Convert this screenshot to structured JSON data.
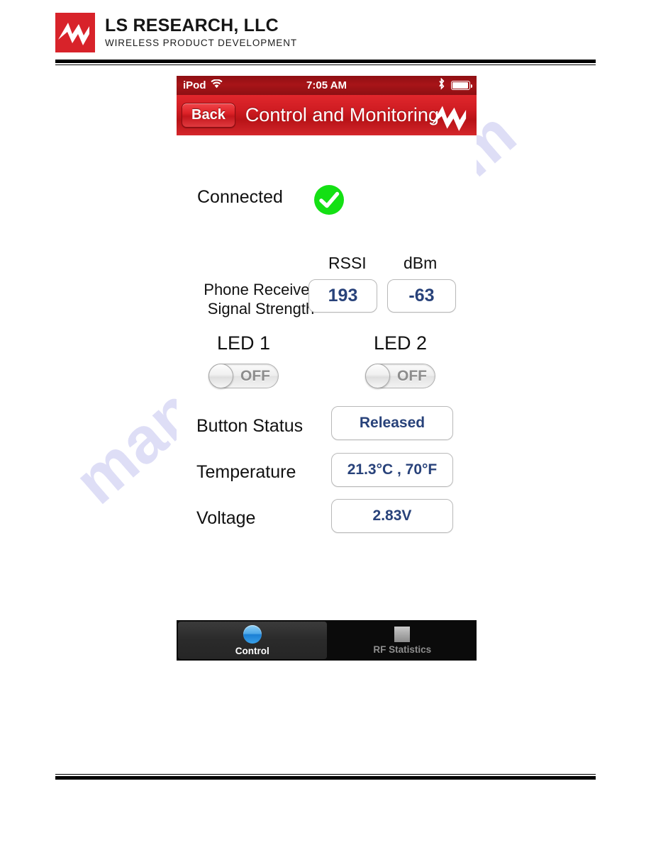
{
  "letterhead": {
    "company_name": "LS RESEARCH, LLC",
    "tagline": "WIRELESS PRODUCT DEVELOPMENT",
    "logo_icon": "ls-research-zigzag-mark",
    "brand_red": "#d8232a"
  },
  "watermark": {
    "text": "manualshive.com",
    "color": "#6f6fd8"
  },
  "phone": {
    "status_bar": {
      "carrier": "iPod",
      "wifi_icon": "wifi-icon",
      "time": "7:05 AM",
      "bluetooth_icon": "bluetooth-icon",
      "battery_icon": "battery-icon"
    },
    "nav_bar": {
      "back_label": "Back",
      "title": "Control and Monitoring",
      "logo_icon": "ls-research-zigzag-mark",
      "bar_color": "#cf1c22"
    },
    "connection": {
      "status_label": "Connected",
      "status_icon": "green-check-circle-icon",
      "status_color": "#14e014"
    },
    "rssi": {
      "row_label_line1": "Phone Received",
      "row_label_line2": "Signal Strength",
      "rssi_header": "RSSI",
      "dbm_header": "dBm",
      "rssi_value": "193",
      "dbm_value": "-63"
    },
    "leds": [
      {
        "label": "LED 1",
        "state": "OFF"
      },
      {
        "label": "LED 2",
        "state": "OFF"
      }
    ],
    "readouts": [
      {
        "label": "Button Status",
        "value": "Released"
      },
      {
        "label": "Temperature",
        "value": "21.3°C , 70°F"
      },
      {
        "label": "Voltage",
        "value": "2.83V"
      }
    ],
    "value_text_color": "#28427a",
    "tabs": [
      {
        "label": "Control",
        "icon": "compass-circle-icon",
        "selected": true
      },
      {
        "label": "RF Statistics",
        "icon": "square-chart-icon",
        "selected": false
      }
    ]
  }
}
